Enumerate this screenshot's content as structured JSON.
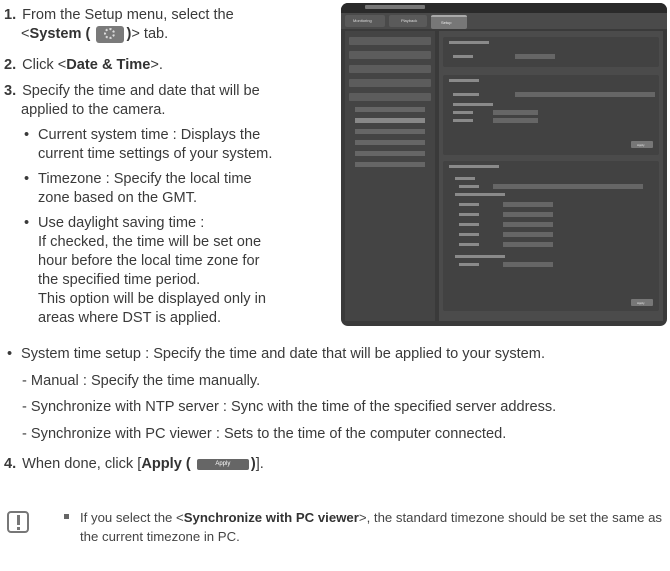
{
  "steps": {
    "s1_num": "1.",
    "s1_a": "From the Setup menu, select the",
    "s1_b_pre": "<",
    "s1_b_bold": "System (",
    "s1_b_bold2": ")",
    "s1_b_post": "> tab.",
    "s2_num": "2.",
    "s2_pre": "Click <",
    "s2_bold": "Date & Time",
    "s2_post": ">.",
    "s3_num": "3.",
    "s3_a": "Specify the time and date that will be",
    "s3_b": "applied to the camera.",
    "s4_num": "4.",
    "s4_pre": "When done, click [",
    "s4_bold": "Apply (",
    "s4_bold2": ")",
    "s4_post": "]."
  },
  "bullets": {
    "b1_a": "Current system time : Displays the",
    "b1_b": "current time settings of your system.",
    "b2_a": "Timezone : Specify the local time",
    "b2_b": "zone based on the GMT.",
    "b3_a": "Use daylight saving time :",
    "b3_b": "If checked, the time will be set one",
    "b3_c": "hour before the local time zone for",
    "b3_d": "the specified time period.",
    "b3_e": "This option will be displayed only in",
    "b3_f": "areas where DST is applied.",
    "b4": "System time setup : Specify the time and date that will be applied to your system.",
    "d1": "- Manual : Specify the time manually.",
    "d2": "- Synchronize with NTP server : Sync with the time of the specified server address.",
    "d3": "- Synchronize with PC viewer : Sets to the time of the computer connected.",
    "dot": "•"
  },
  "apply_button_label": "Apply",
  "screenshot": {
    "tab_monitoring": "Monitoring",
    "tab_playback": "Playback",
    "tab_setup": "Setup",
    "apply_1": "Apply",
    "apply_2": "Apply"
  },
  "note": {
    "pre": "If you select the <",
    "bold": "Synchronize with PC viewer",
    "post": ">, the standard timezone should be set the same as the current timezone in PC."
  }
}
